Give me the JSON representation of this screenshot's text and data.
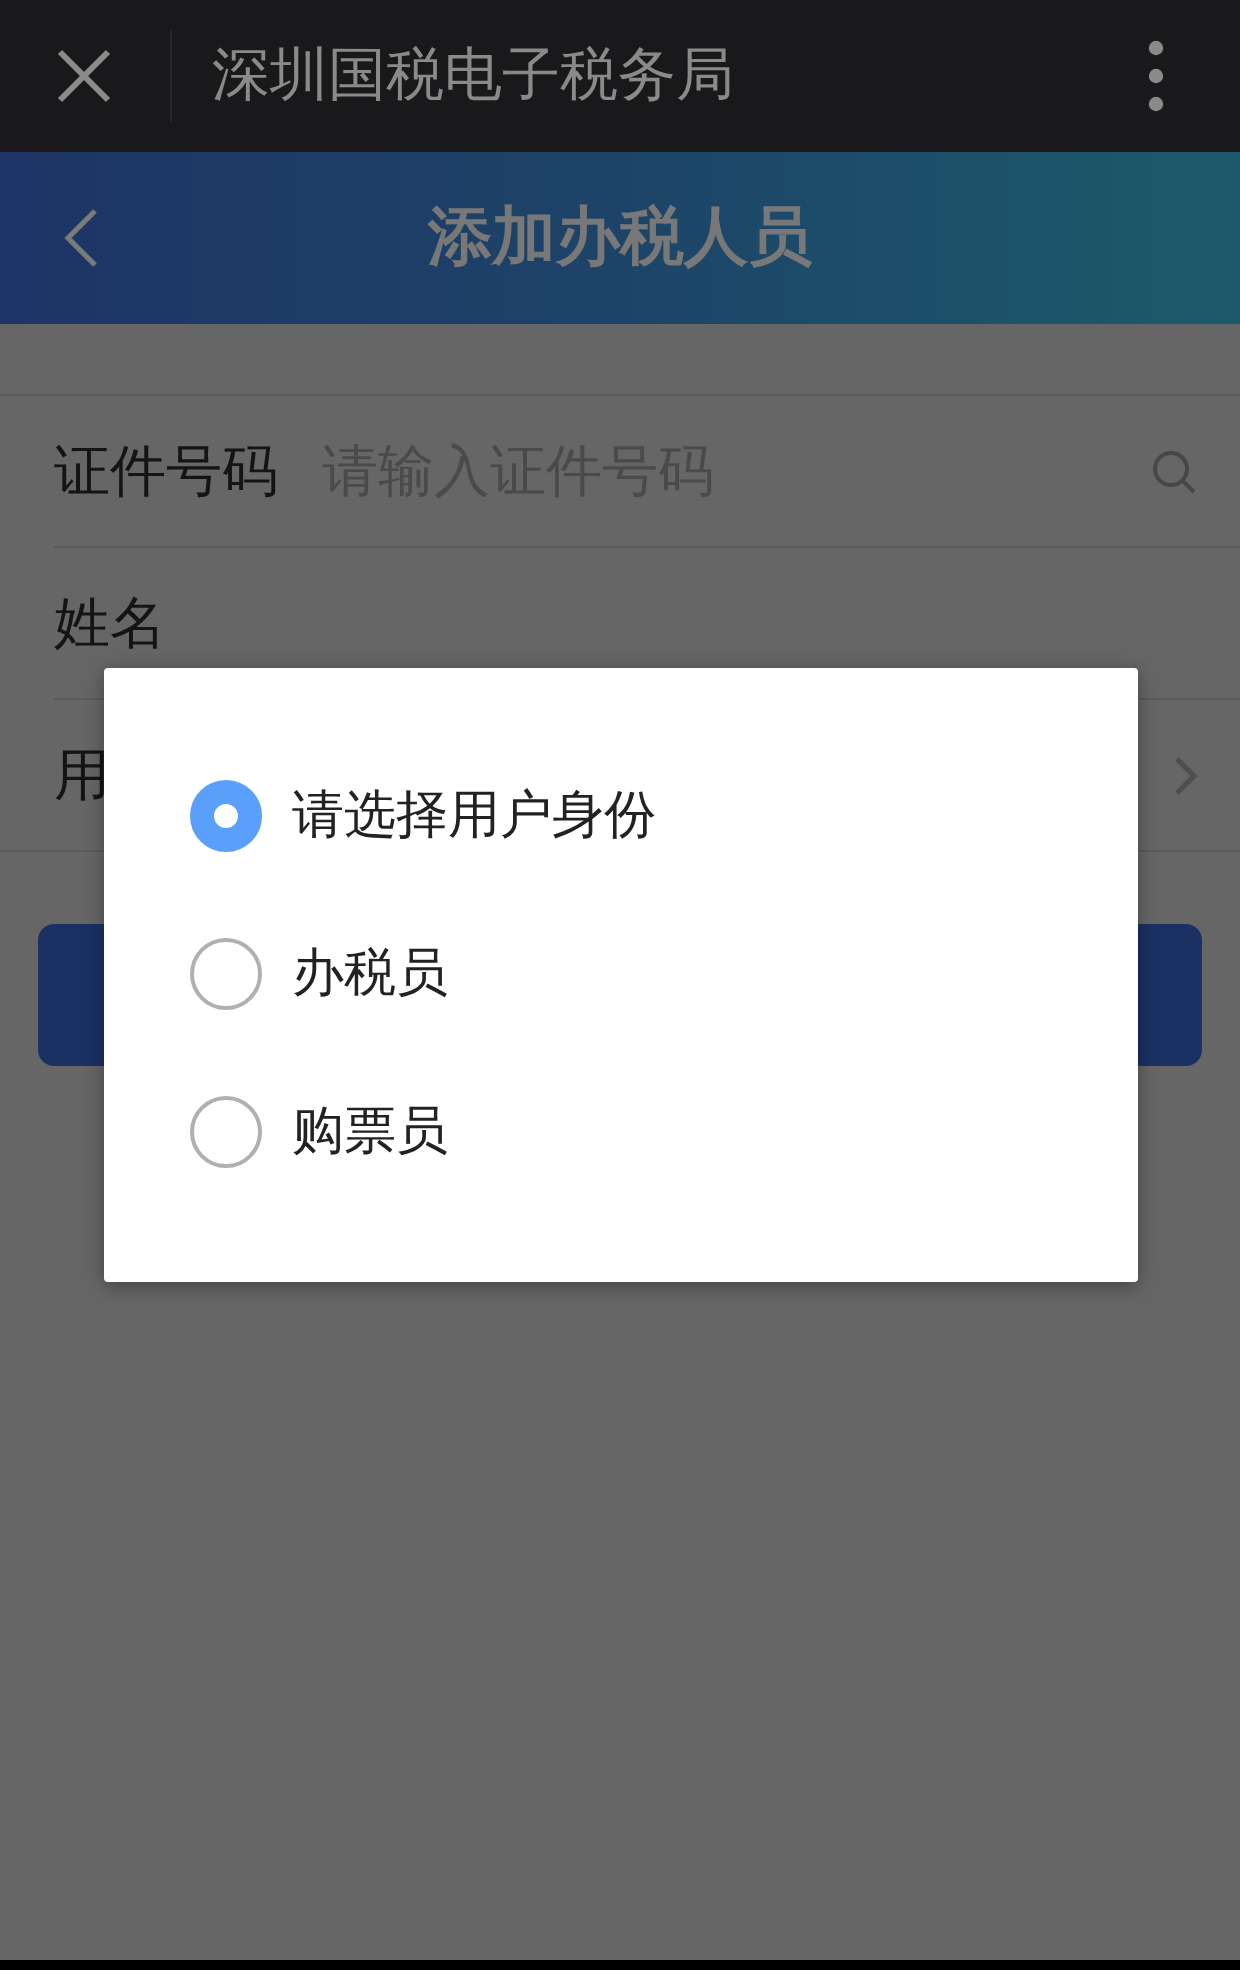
{
  "top_bar": {
    "title": "深圳国税电子税务局"
  },
  "header": {
    "title": "添加办税人员"
  },
  "form": {
    "rows": [
      {
        "kind": "input",
        "label": "证件号码",
        "placeholder": "请输入证件号码"
      },
      {
        "kind": "text",
        "label": "姓名"
      },
      {
        "kind": "select",
        "label": "用"
      }
    ]
  },
  "dialog": {
    "options": [
      {
        "label": "请选择用户身份",
        "selected": true
      },
      {
        "label": "办税员",
        "selected": false
      },
      {
        "label": "购票员",
        "selected": false
      }
    ]
  }
}
